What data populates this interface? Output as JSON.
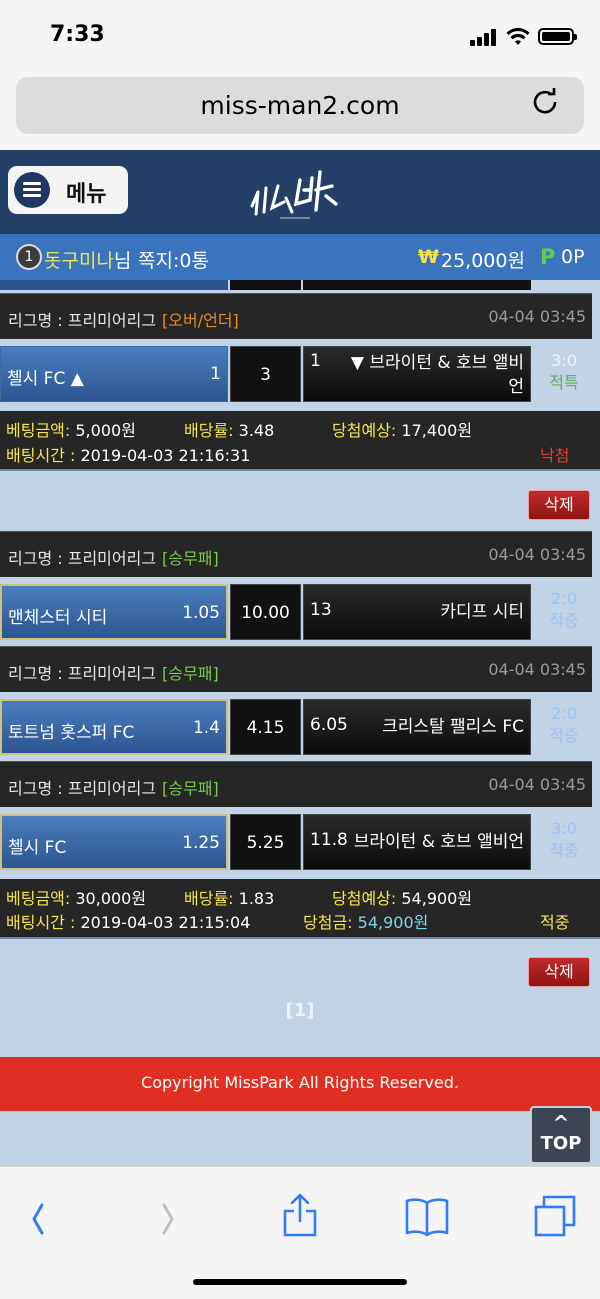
{
  "status_bar": {
    "time": "7:33"
  },
  "browser": {
    "url": "miss-man2.com"
  },
  "header": {
    "menu_label": "메뉴",
    "logo_text": "미스박"
  },
  "user_bar": {
    "level": "1",
    "username": "돗구미나",
    "honorific": "님",
    "messages": "쪽지:0통",
    "currency_symbol": "₩",
    "balance": "25,000원",
    "points_symbol": "P",
    "points": "0P"
  },
  "bets": [
    {
      "matches": [
        {
          "league": "리그명 : 프리미어리그",
          "bet_type": "[오버/언더]",
          "date": "04-04 03:45",
          "home_team": "첼시 FC ▲",
          "home_odds": "1",
          "draw": "3",
          "away_odds": "1",
          "away_team": "▼ 브라이턴 & 호브 앨비",
          "away_team_line2": "언",
          "score": "3:0",
          "result": "적특"
        }
      ],
      "summary": {
        "amount_label": "베팅금액:",
        "amount": "5,000원",
        "rate_label": "배당률:",
        "rate": "3.48",
        "expected_label": "당첨예상:",
        "expected": "17,400원",
        "time_label": "배팅시간 :",
        "time": "2019-04-03 21:16:31",
        "status": "낙첨"
      },
      "delete_label": "삭제"
    },
    {
      "matches": [
        {
          "league": "리그명 : 프리미어리그",
          "bet_type": "[승무패]",
          "date": "04-04 03:45",
          "home_team": "맨체스터 시티",
          "home_odds": "1.05",
          "draw": "10.00",
          "away_odds": "13",
          "away_team": "카디프 시티",
          "score": "2:0",
          "result": "적중"
        },
        {
          "league": "리그명 : 프리미어리그",
          "bet_type": "[승무패]",
          "date": "04-04 03:45",
          "home_team": "토트넘 홋스퍼 FC",
          "home_odds": "1.4",
          "draw": "4.15",
          "away_odds": "6.05",
          "away_team": "크리스탈 팰리스 FC",
          "score": "2:0",
          "result": "적중"
        },
        {
          "league": "리그명 : 프리미어리그",
          "bet_type": "[승무패]",
          "date": "04-04 03:45",
          "home_team": "첼시 FC",
          "home_odds": "1.25",
          "draw": "5.25",
          "away_odds": "11.8",
          "away_team": "브라이턴 & 호브 앨비언",
          "score": "3:0",
          "result": "적중"
        }
      ],
      "summary": {
        "amount_label": "베팅금액:",
        "amount": "30,000원",
        "rate_label": "배당률:",
        "rate": "1.83",
        "expected_label": "당첨예상:",
        "expected": "54,900원",
        "time_label": "배팅시간 :",
        "time": "2019-04-03 21:15:04",
        "win_label": "당첨금:",
        "win_amount": "54,900원",
        "status": "적중"
      },
      "delete_label": "삭제"
    }
  ],
  "pagination": {
    "current": "[1]"
  },
  "footer": {
    "copyright": "Copyright MissPark All Rights Reserved."
  },
  "top_button": {
    "arrow": "^",
    "label": "TOP"
  },
  "colors": {
    "header_bg": "#243f68",
    "user_bar_bg": "#3a74be",
    "page_bg": "#c3d3e6",
    "footer_bg": "#e12e22",
    "accent_yellow": "#f7e34a",
    "win_green": "#54b35a",
    "lost_red": "#e53b3b"
  },
  "icons": {
    "toolbar": [
      "back-icon",
      "forward-icon",
      "share-icon",
      "bookmarks-icon",
      "tabs-icon"
    ]
  }
}
